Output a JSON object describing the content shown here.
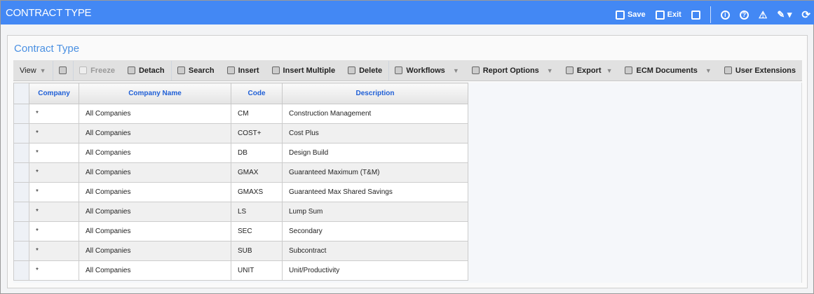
{
  "header": {
    "title": "CONTRACT TYPE",
    "save": "Save",
    "exit": "Exit"
  },
  "panel": {
    "title": "Contract Type"
  },
  "toolbar": {
    "view": "View",
    "freeze": "Freeze",
    "detach": "Detach",
    "search": "Search",
    "insert": "Insert",
    "insert_multiple": "Insert Multiple",
    "delete": "Delete",
    "workflows": "Workflows",
    "report_options": "Report Options",
    "export": "Export",
    "ecm_documents": "ECM Documents",
    "user_extensions": "User Extensions"
  },
  "table": {
    "columns": [
      "Company",
      "Company Name",
      "Code",
      "Description"
    ],
    "rows": [
      [
        "*",
        "All Companies",
        "CM",
        "Construction Management"
      ],
      [
        "*",
        "All Companies",
        "COST+",
        "Cost Plus"
      ],
      [
        "*",
        "All Companies",
        "DB",
        "Design Build"
      ],
      [
        "*",
        "All Companies",
        "GMAX",
        "Guaranteed Maximum (T&M)"
      ],
      [
        "*",
        "All Companies",
        "GMAXS",
        "Guaranteed Max Shared Savings"
      ],
      [
        "*",
        "All Companies",
        "LS",
        "Lump Sum"
      ],
      [
        "*",
        "All Companies",
        "SEC",
        "Secondary"
      ],
      [
        "*",
        "All Companies",
        "SUB",
        "Subcontract"
      ],
      [
        "*",
        "All Companies",
        "UNIT",
        "Unit/Productivity"
      ]
    ]
  }
}
